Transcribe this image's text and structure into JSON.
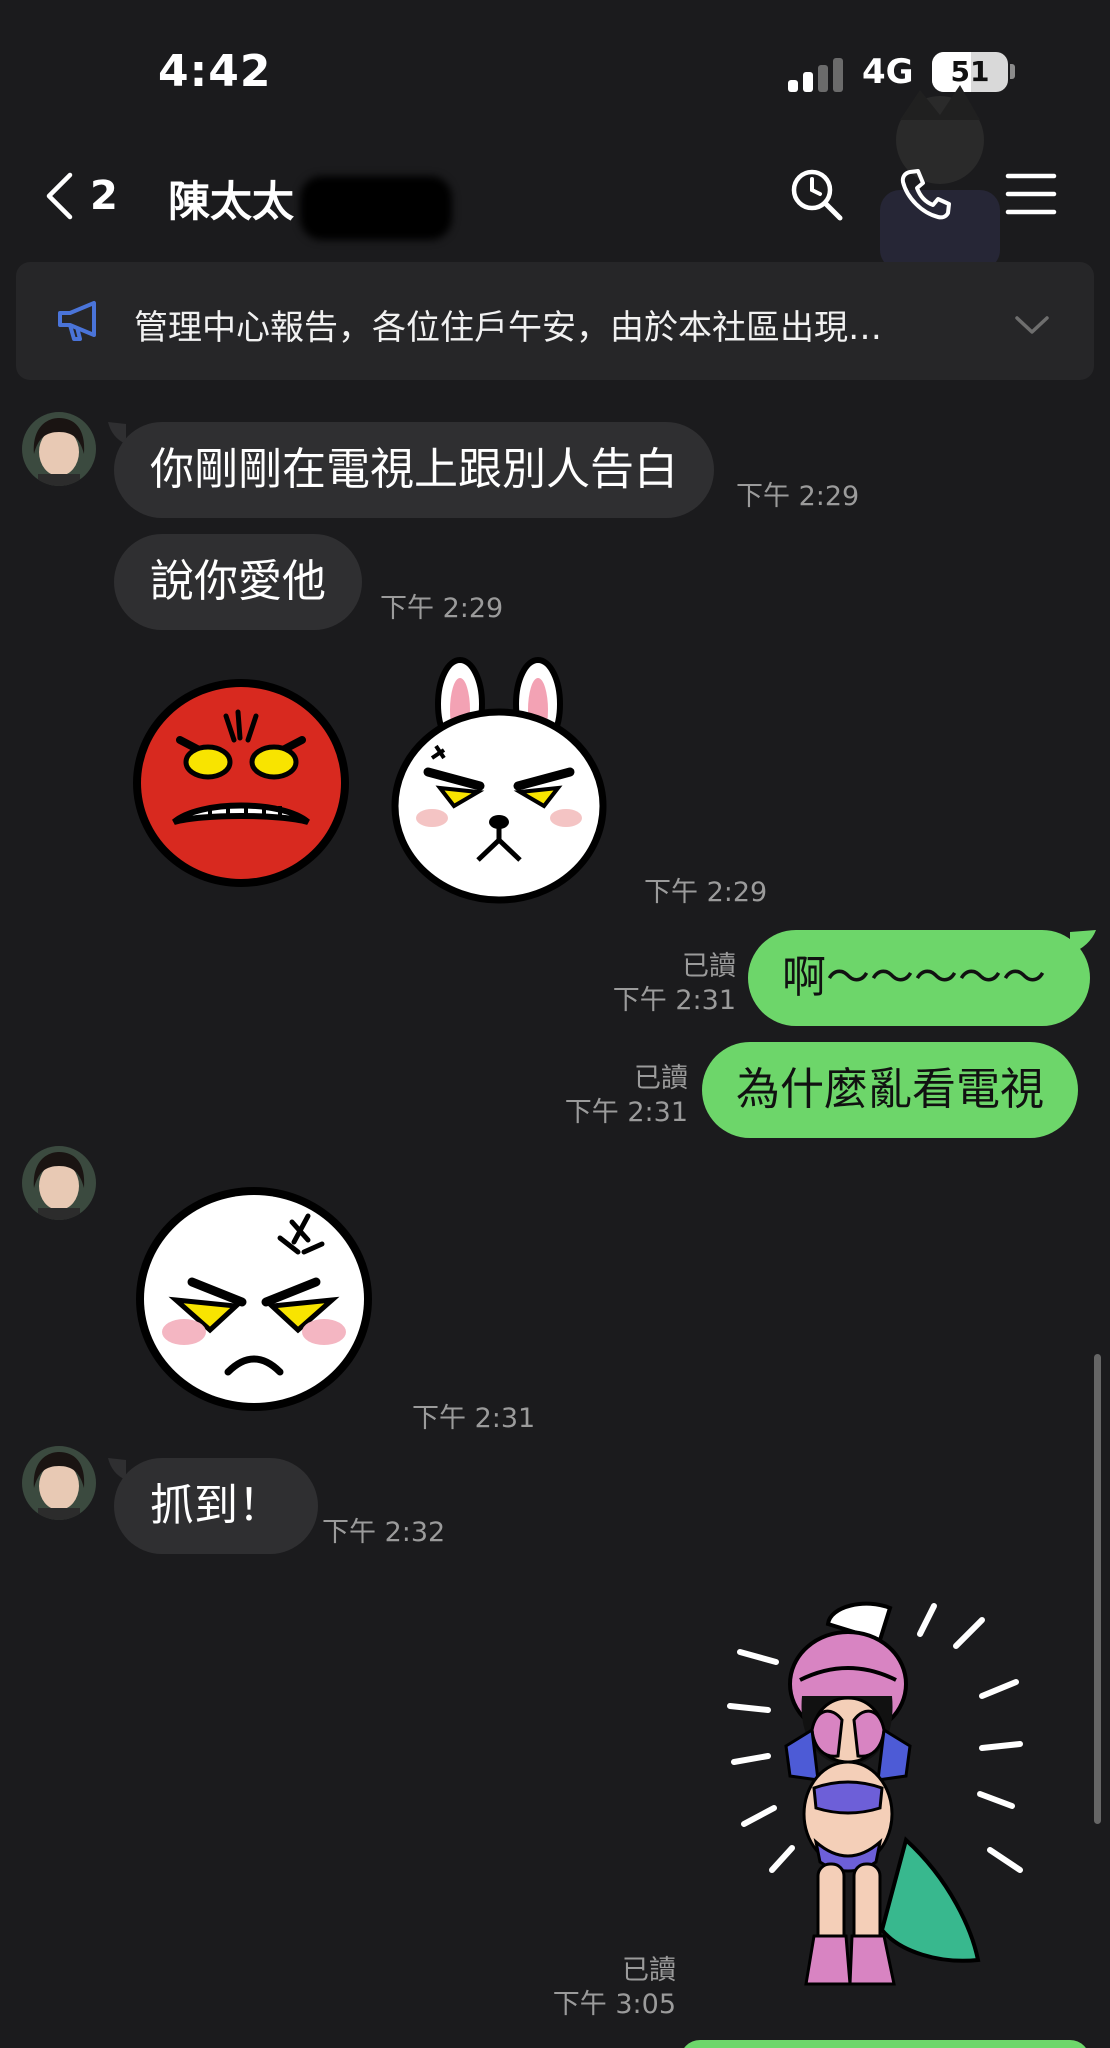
{
  "status_bar": {
    "time": "4:42",
    "network": "4G",
    "battery": "51",
    "battery_level": 0.51,
    "signal_bars_active": 2,
    "signal_bars_total": 4
  },
  "header": {
    "back_count": "2",
    "title": "陳太太",
    "icons": [
      "search-icon",
      "phone-icon",
      "menu-icon"
    ]
  },
  "announcement": {
    "text": "管理中心報告，各位住戶午安，由於本社區出現…",
    "icon": "megaphone-icon"
  },
  "messages": [
    {
      "side": "in",
      "type": "text",
      "text": "你剛剛在電視上跟別人告白",
      "time": "下午 2:29"
    },
    {
      "side": "in",
      "type": "text",
      "text": "說你愛他",
      "time": "下午 2:29"
    },
    {
      "side": "in",
      "type": "stickers",
      "stickers": [
        "angry-red-face-sticker",
        "angry-rabbit-sticker"
      ],
      "time": "下午 2:29"
    },
    {
      "side": "out",
      "type": "text",
      "text": "啊～～～～～",
      "read": "已讀",
      "time": "下午 2:31"
    },
    {
      "side": "out",
      "type": "text",
      "text": "為什麼亂看電視",
      "read": "已讀",
      "time": "下午 2:31"
    },
    {
      "side": "in",
      "type": "sticker",
      "sticker": "angry-white-face-sticker",
      "time": "下午 2:31"
    },
    {
      "side": "in",
      "type": "text",
      "text": "抓到！",
      "time": "下午 2:32"
    },
    {
      "side": "out",
      "type": "sticker",
      "sticker": "crying-girl-armor-sticker",
      "read": "已讀",
      "time": "下午 3:05"
    }
  ],
  "colors": {
    "background": "#1b1b1d",
    "incoming_bubble": "#2f2f31",
    "outgoing_bubble": "#6dd66a",
    "timestamp": "#9b9b9b",
    "accent_icon": "#4a74d9"
  }
}
